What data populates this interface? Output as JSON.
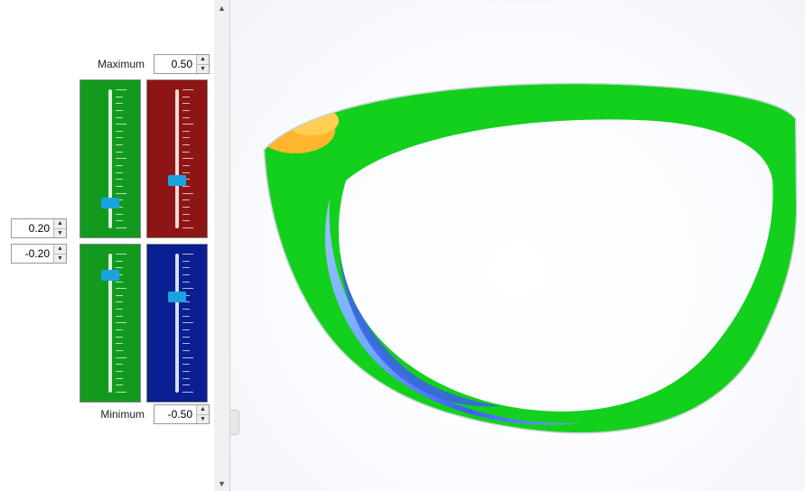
{
  "labels": {
    "maximum": "Maximum",
    "minimum": "Minimum"
  },
  "spinners": {
    "max": "0.50",
    "min": "-0.50",
    "upper_threshold": "0.20",
    "lower_threshold": "-0.20"
  },
  "sliders": {
    "top_left": {
      "bg": "green",
      "thumb_pct": 80
    },
    "top_right": {
      "bg": "red",
      "thumb_pct": 63
    },
    "bot_left": {
      "bg": "green",
      "thumb_pct": 12
    },
    "bot_right": {
      "bg": "blue",
      "thumb_pct": 28
    }
  },
  "colormap": {
    "high": "#ffb62e",
    "ok": "#13d01d",
    "low1": "#6fa8ff",
    "low2": "#3d5ef0"
  }
}
